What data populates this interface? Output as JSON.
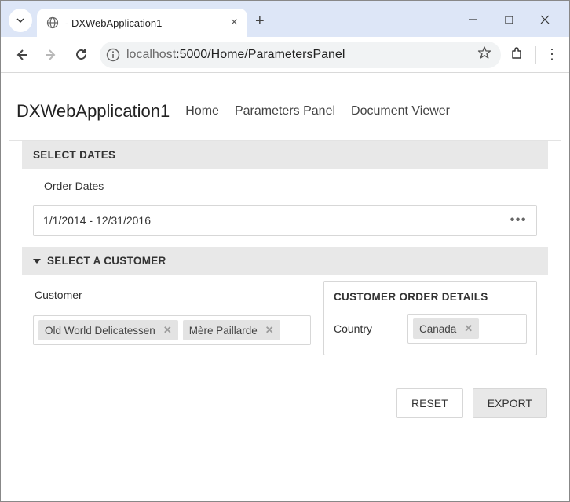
{
  "browser": {
    "tab_title": " - DXWebApplication1",
    "url_host": "localhost",
    "url_path": ":5000/Home/ParametersPanel"
  },
  "app": {
    "title": "DXWebApplication1",
    "nav": {
      "home": "Home",
      "params": "Parameters Panel",
      "viewer": "Document Viewer"
    }
  },
  "sections": {
    "dates": {
      "header": "SELECT DATES",
      "label": "Order Dates",
      "value": "1/1/2014 - 12/31/2016"
    },
    "customer": {
      "header": "SELECT A CUSTOMER",
      "label": "Customer",
      "tags": {
        "0": "Old World Delicatessen",
        "1": "Mère Paillarde"
      },
      "details": {
        "header": "CUSTOMER ORDER DETAILS",
        "country_label": "Country",
        "country_value": "Canada"
      }
    }
  },
  "buttons": {
    "reset": "RESET",
    "export": "EXPORT"
  }
}
